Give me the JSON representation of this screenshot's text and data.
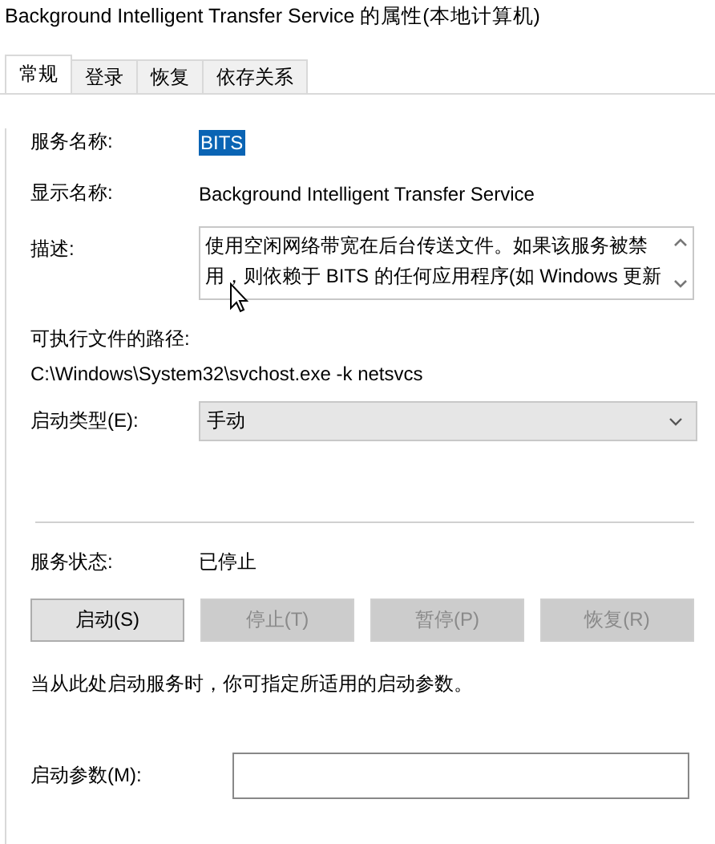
{
  "window": {
    "title": "Background Intelligent Transfer Service 的属性(本地计算机)"
  },
  "tabs": [
    {
      "label": "常规",
      "selected": true
    },
    {
      "label": "登录",
      "selected": false
    },
    {
      "label": "恢复",
      "selected": false
    },
    {
      "label": "依存关系",
      "selected": false
    }
  ],
  "service_name": {
    "label": "服务名称:",
    "value": "BITS",
    "highlighted": true
  },
  "display_name": {
    "label": "显示名称:",
    "value": "Background Intelligent Transfer Service"
  },
  "description": {
    "label": "描述:",
    "value": "使用空闲网络带宽在后台传送文件。如果该服务被禁用，则依赖于 BITS 的任何应用程序(如 Windows 更新"
  },
  "executable_path": {
    "label": "可执行文件的路径:",
    "value": "C:\\Windows\\System32\\svchost.exe -k netsvcs"
  },
  "startup_type": {
    "label": "启动类型(E):",
    "value": "手动"
  },
  "service_status": {
    "label": "服务状态:",
    "value": "已停止"
  },
  "buttons": [
    {
      "label": "启动(S)",
      "disabled": false
    },
    {
      "label": "停止(T)",
      "disabled": true
    },
    {
      "label": "暂停(P)",
      "disabled": true
    },
    {
      "label": "恢复(R)",
      "disabled": true
    }
  ],
  "hint": "当从此处启动服务时，你可指定所适用的启动参数。",
  "start_parameters": {
    "label": "启动参数(M):"
  }
}
